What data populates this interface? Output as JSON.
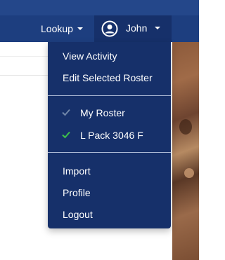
{
  "navbar": {
    "lookup_label": "Lookup",
    "user_label": "John"
  },
  "dropdown": {
    "view_activity": "View Activity",
    "edit_selected_roster": "Edit Selected Roster",
    "rosters": [
      {
        "label": "My Roster",
        "check_color": "#6f85a8"
      },
      {
        "label": "L Pack 3046 F",
        "check_color": "#3ec24a"
      }
    ],
    "import": "Import",
    "profile": "Profile",
    "logout": "Logout"
  },
  "colors": {
    "navbar": "#1d3e7f",
    "dropdown": "#16306a",
    "divider": "#aebbd6"
  },
  "icons": [
    "user-circle-icon",
    "caret-down-icon",
    "check-icon"
  ]
}
